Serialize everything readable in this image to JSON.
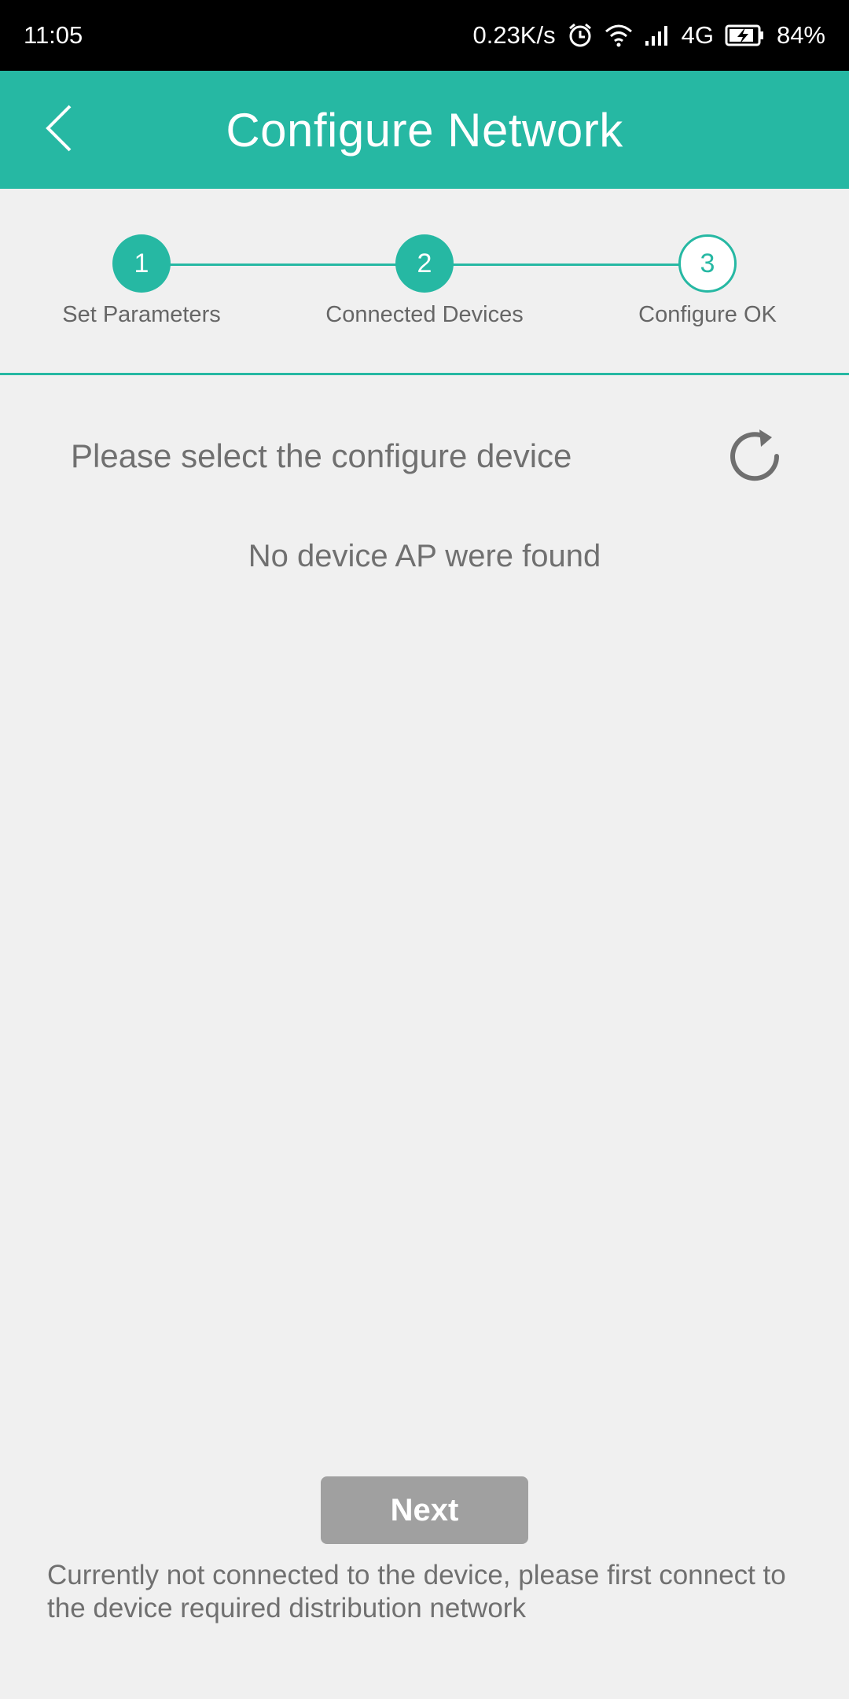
{
  "status_bar": {
    "time": "11:05",
    "net_speed": "0.23K/s",
    "network_type": "4G",
    "battery": "84%",
    "icons": [
      "alarm-icon",
      "wifi-icon",
      "signal-icon",
      "battery-charging-icon"
    ]
  },
  "app_bar": {
    "title": "Configure Network",
    "back_icon": "chevron-left-icon",
    "color": "#26b8a3"
  },
  "stepper": {
    "steps": [
      {
        "number": "1",
        "label": "Set Parameters",
        "state": "done"
      },
      {
        "number": "2",
        "label": "Connected Devices",
        "state": "done"
      },
      {
        "number": "3",
        "label": "Configure OK",
        "state": "todo"
      }
    ]
  },
  "device_list": {
    "title": "Please select the configure device",
    "refresh_icon": "refresh-icon",
    "empty_message": "No device AP were found"
  },
  "footer": {
    "next_label": "Next",
    "hint": "Currently not connected to the device, please first connect to the device required distribution network"
  }
}
